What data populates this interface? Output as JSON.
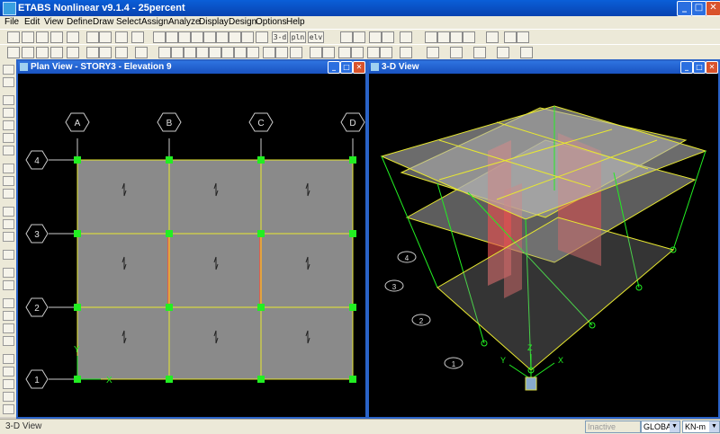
{
  "app": {
    "title": "ETABS Nonlinear v9.1.4 - 25percent"
  },
  "window_controls": {
    "minimize": "_",
    "maximize": "□",
    "close": "✕"
  },
  "menu": [
    "File",
    "Edit",
    "View",
    "Define",
    "Draw",
    "Select",
    "Assign",
    "Analyze",
    "Display",
    "Design",
    "Options",
    "Help"
  ],
  "toolbar": {
    "view_3d_label": "3-d",
    "plan_label": "pln",
    "elevation_label": "elv"
  },
  "plan_view": {
    "title": "Plan View - STORY3 - Elevation 9",
    "grid_x": [
      "A",
      "B",
      "C",
      "D"
    ],
    "grid_y": [
      "4",
      "3",
      "2",
      "1"
    ],
    "axis_x": "X",
    "axis_y": "Y"
  },
  "view_3d": {
    "title": "3-D View",
    "grid_labels": [
      "4",
      "3",
      "2",
      "1"
    ],
    "axis_x": "X",
    "axis_y": "Y",
    "axis_z": "Z"
  },
  "status": {
    "text": "3-D View",
    "state": "Inactive",
    "coord_system": "GLOBAL",
    "units": "KN-m"
  },
  "colors": {
    "grid": "#e8e830",
    "joint": "#22ee22",
    "slab": "#8a8a8a",
    "wall": "#e84040",
    "bubble": "#d8d8d8"
  }
}
